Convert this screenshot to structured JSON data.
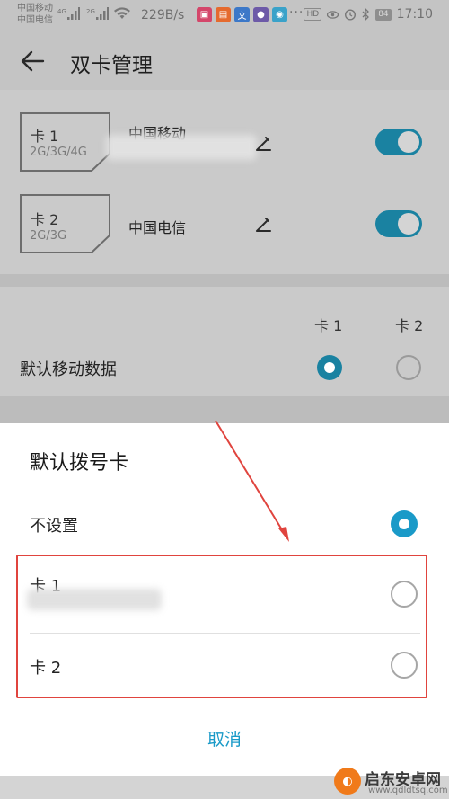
{
  "status_bar": {
    "carrier_1": "中国移动",
    "carrier_2": "中国电信",
    "net_1": "4G",
    "net_2": "2G",
    "speed": "229B/s",
    "overflow": "···",
    "hd": "HD",
    "battery": "84",
    "time": "17:10"
  },
  "header": {
    "title": "双卡管理"
  },
  "sim_cards": [
    {
      "label": "卡 1",
      "types": "2G/3G/4G",
      "carrier": "中国移动",
      "enabled": true
    },
    {
      "label": "卡 2",
      "types": "2G/3G",
      "carrier": "中国电信",
      "enabled": true
    }
  ],
  "default_data": {
    "col_1": "卡 1",
    "col_2": "卡 2",
    "label": "默认移动数据",
    "selected": "卡 1"
  },
  "dialog": {
    "title": "默认拨号卡",
    "options": [
      {
        "label": "不设置",
        "selected": true
      },
      {
        "label": "卡 1",
        "selected": false
      },
      {
        "label": "卡 2",
        "selected": false
      }
    ],
    "cancel_label": "取消"
  },
  "colors": {
    "accent": "#1a9ac8",
    "toggle_on": "#1a82a1",
    "annotation": "#e0443e",
    "watermark": "#f07a1a"
  },
  "watermark": {
    "name": "启东安卓网",
    "url": "www.qdldtsq.com"
  }
}
